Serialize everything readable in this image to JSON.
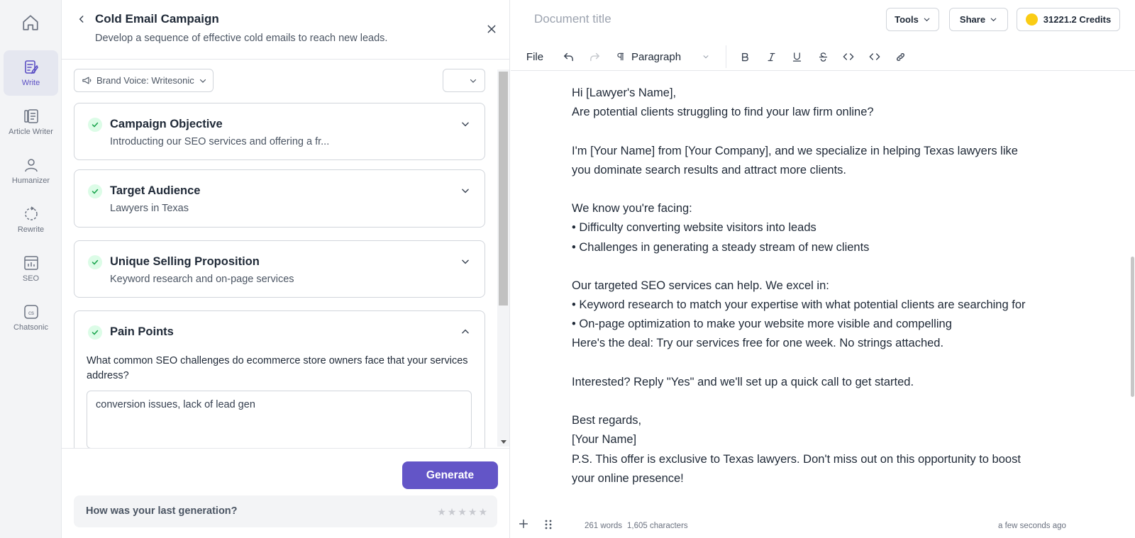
{
  "nav": {
    "items": [
      {
        "label": "Write",
        "icon": "write-icon"
      },
      {
        "label": "Article Writer",
        "icon": "article-icon"
      },
      {
        "label": "Humanizer",
        "icon": "person-icon"
      },
      {
        "label": "Rewrite",
        "icon": "rewrite-icon"
      },
      {
        "label": "SEO",
        "icon": "chart-icon"
      },
      {
        "label": "Chatsonic",
        "icon": "chatsonic-icon"
      }
    ],
    "chatsonic_glyph": "cs"
  },
  "panel": {
    "title": "Cold Email Campaign",
    "subtitle": "Develop a sequence of effective cold emails to reach new leads.",
    "brand_voice": "Brand Voice: Writesonic",
    "cards": [
      {
        "title": "Campaign Objective",
        "value": "Introducting our SEO services and offering a fr..."
      },
      {
        "title": "Target Audience",
        "value": "Lawyers in Texas"
      },
      {
        "title": "Unique Selling Proposition",
        "value": "Keyword research and on-page services"
      },
      {
        "title": "Pain Points",
        "question": "What common SEO challenges do ecommerce store owners face that your services address?",
        "answer": "conversion issues, lack of lead gen"
      }
    ],
    "generate_label": "Generate",
    "feedback_question": "How was your last generation?"
  },
  "editor": {
    "doc_title_placeholder": "Document title",
    "tools_label": "Tools",
    "share_label": "Share",
    "credits_label": "31221.2 Credits",
    "toolbar": {
      "file_label": "File",
      "paragraph_label": "Paragraph"
    },
    "content_lines": [
      "Hi [Lawyer's Name],",
      "Are potential clients struggling to find your law firm online?",
      "",
      "I'm [Your Name] from [Your Company], and we specialize in helping Texas lawyers like",
      "you dominate search results and attract more clients.",
      "",
      "We know you're facing:",
      "• Difficulty converting website visitors into leads",
      "• Challenges in generating a steady stream of new clients",
      "",
      "Our targeted SEO services can help. We excel in:",
      "• Keyword research to match your expertise with what potential clients are searching for",
      "• On-page optimization to make your website more visible and compelling",
      "Here's the deal: Try our services free for one week. No strings attached.",
      "",
      "Interested? Reply \"Yes\" and we'll set up a quick call to get started.",
      "",
      "Best regards,",
      "[Your Name]",
      "P.S. This offer is exclusive to Texas lawyers. Don't miss out on this opportunity to boost",
      "your online presence!"
    ],
    "status": {
      "words": "261 words",
      "characters": "1,605 characters",
      "saved": "a few seconds ago"
    }
  },
  "colors": {
    "accent": "#6355c7",
    "check_bg": "#dcfce7",
    "check_stroke": "#16a34a",
    "coin": "#facc15"
  }
}
